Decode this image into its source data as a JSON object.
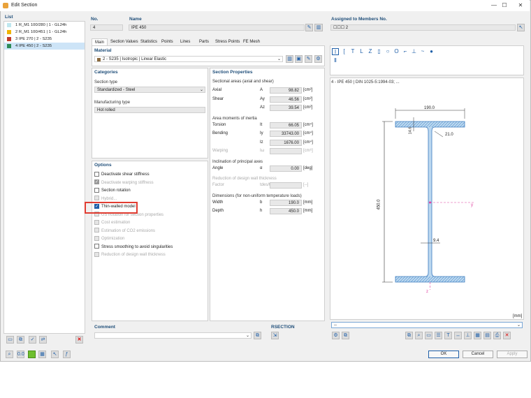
{
  "window": {
    "title": "Edit Section",
    "minimize": "—",
    "maximize": "☐",
    "close": "✕"
  },
  "list": {
    "header": "List",
    "items": [
      {
        "label": "1 R_M1 100/280 | 1 - GL24h",
        "color": "#bfe7ef"
      },
      {
        "label": "2 R_M1 100/451 | 1 - GL24h",
        "color": "#f0b400"
      },
      {
        "label": "3 IPE 270 | 2 - S235",
        "color": "#c0392b"
      },
      {
        "label": "4 IPE 450 | 2 - S235",
        "color": "#2e8b57"
      }
    ]
  },
  "no": {
    "label": "No.",
    "value": "4"
  },
  "name": {
    "label": "Name",
    "value": "IPE 450"
  },
  "assigned": {
    "label": "Assigned to Members No.",
    "value": "☐☐☐ 2"
  },
  "tabs": [
    "Main",
    "Section Values",
    "Statistics",
    "Points",
    "Lines",
    "Parts",
    "Stress Points",
    "FE Mesh"
  ],
  "material": {
    "label": "Material",
    "value": "2 - S235 | Isotropic | Linear Elastic"
  },
  "categories": {
    "header": "Categories",
    "section_type_label": "Section type",
    "section_type": "Standardized - Steel",
    "manufacturing_label": "Manufacturing type",
    "manufacturing": "Hot rolled"
  },
  "options": {
    "header": "Options",
    "items": [
      {
        "label": "Deactivate shear stiffness",
        "checked": false,
        "disabled": false
      },
      {
        "label": "Deactivate warping stiffness",
        "checked": true,
        "disabled": true
      },
      {
        "label": "Section rotation",
        "checked": false,
        "disabled": false
      },
      {
        "label": "Hybrid...",
        "checked": false,
        "disabled": true
      },
      {
        "label": "Thin-walled model",
        "checked": true,
        "disabled": false
      },
      {
        "label": "US notation for section properties",
        "checked": false,
        "disabled": true
      },
      {
        "label": "Cost estimation",
        "checked": false,
        "disabled": true
      },
      {
        "label": "Estimation of CO2 emissions",
        "checked": false,
        "disabled": true
      },
      {
        "label": "Optimization",
        "checked": false,
        "disabled": true
      },
      {
        "label": "Stress smoothing to avoid singularities",
        "checked": false,
        "disabled": false
      },
      {
        "label": "Reduction of design wall thickness",
        "checked": false,
        "disabled": true
      }
    ]
  },
  "props": {
    "header": "Section Properties",
    "areas_header": "Sectional areas (axial and shear)",
    "rows1": [
      {
        "name": "Axial",
        "sym": "A",
        "val": "98.82",
        "unit": "[cm²]"
      },
      {
        "name": "Shear",
        "sym": "Ay",
        "val": "46.56",
        "unit": "[cm²]"
      },
      {
        "name": "",
        "sym": "Az",
        "val": "39.54",
        "unit": "[cm²]"
      }
    ],
    "moments_header": "Area moments of inertia",
    "rows2": [
      {
        "name": "Torsion",
        "sym": "It",
        "val": "66.05",
        "unit": "[cm⁴]"
      },
      {
        "name": "Bending",
        "sym": "Iy",
        "val": "33743.00",
        "unit": "[cm⁴]"
      },
      {
        "name": "",
        "sym": "Iz",
        "val": "1676.00",
        "unit": "[cm⁴]"
      },
      {
        "name": "Warping",
        "sym": "Iω",
        "val": "",
        "unit": "[cm⁶]"
      }
    ],
    "incl_header": "Inclination of principal axes",
    "angle": {
      "name": "Angle",
      "sym": "α",
      "val": "0.00",
      "unit": "[deg]"
    },
    "red_header": "Reduction of design wall thickness",
    "factor": {
      "name": "Factor",
      "sym": "tdes/t",
      "val": "",
      "unit": "[--]"
    },
    "dim_header": "Dimensions (for non-uniform temperature loads)",
    "rows3": [
      {
        "name": "Width",
        "sym": "b",
        "val": "190.0",
        "unit": "[mm]"
      },
      {
        "name": "Depth",
        "sym": "h",
        "val": "450.0",
        "unit": "[mm]"
      }
    ]
  },
  "preview": {
    "caption": "4 - IPE 450 | DIN 1025-5:1994-03; ...",
    "dim_b": "190.0",
    "dim_h": "450.0",
    "dim_tf": "14.6",
    "dim_r": "21.0",
    "dim_tw": "9.4",
    "axis_y": "y",
    "axis_z": "z",
    "unit": "[mm]",
    "select": "--"
  },
  "comment": {
    "label": "Comment"
  },
  "rsection": {
    "label": "RSECTION"
  },
  "buttons": {
    "ok": "OK",
    "cancel": "Cancel",
    "apply": "Apply"
  }
}
